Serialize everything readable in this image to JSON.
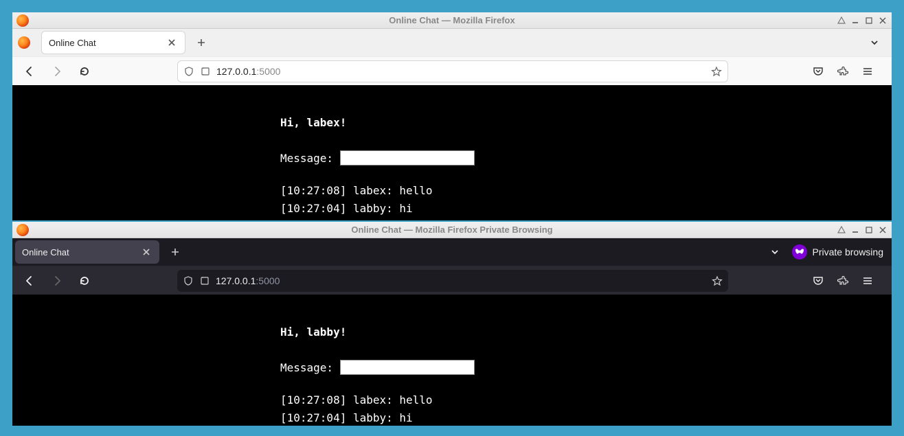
{
  "window1": {
    "title": "Online Chat — Mozilla Firefox",
    "tab_label": "Online Chat",
    "url_host": "127.0.0.1",
    "url_port": ":5000",
    "page": {
      "greeting": "Hi, labex!",
      "message_label": "Message:",
      "input_value": "",
      "log": [
        "[10:27:08] labex: hello",
        "[10:27:04] labby: hi"
      ]
    }
  },
  "window2": {
    "title": "Online Chat — Mozilla Firefox Private Browsing",
    "tab_label": "Online Chat",
    "private_label": "Private browsing",
    "url_host": "127.0.0.1",
    "url_port": ":5000",
    "page": {
      "greeting": "Hi, labby!",
      "message_label": "Message:",
      "input_value": "",
      "log": [
        "[10:27:08] labex: hello",
        "[10:27:04] labby: hi"
      ]
    }
  }
}
